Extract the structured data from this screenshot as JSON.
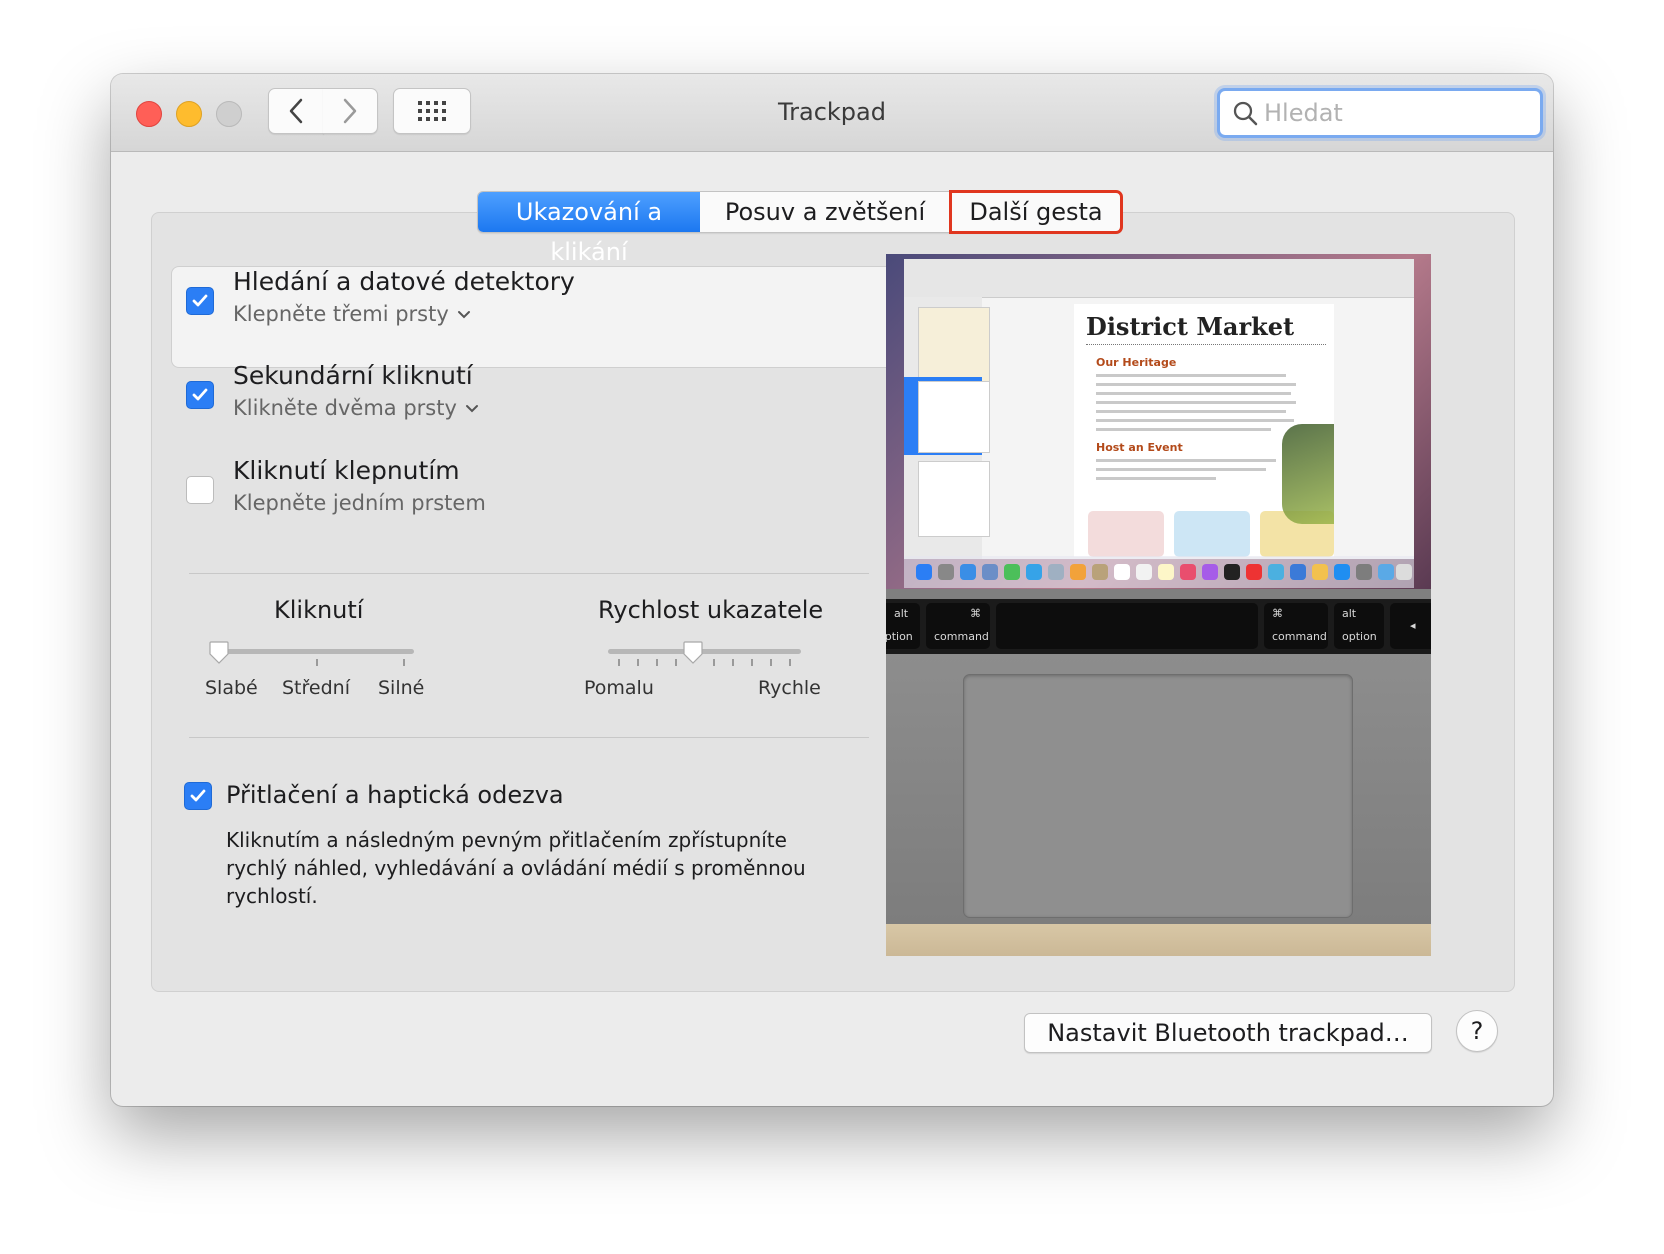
{
  "window": {
    "title": "Trackpad",
    "search_placeholder": "Hledat"
  },
  "tabs": [
    {
      "label": "Ukazování a klikání",
      "active": true
    },
    {
      "label": "Posuv a zvětšení",
      "active": false
    },
    {
      "label": "Další gesta",
      "active": false,
      "highlighted": true
    }
  ],
  "options": [
    {
      "title": "Hledání a datové detektory",
      "subtitle": "Klepněte třemi prsty",
      "checked": true,
      "has_menu": true
    },
    {
      "title": "Sekundární kliknutí",
      "subtitle": "Klikněte dvěma prsty",
      "checked": true,
      "has_menu": true
    },
    {
      "title": "Kliknutí klepnutím",
      "subtitle": "Klepněte jedním prstem",
      "checked": false,
      "has_menu": false
    }
  ],
  "sliders": {
    "click": {
      "title": "Kliknutí",
      "labels": [
        "Slabé",
        "Střední",
        "Silné"
      ],
      "value_fraction": 0.0
    },
    "tracking": {
      "title": "Rychlost ukazatele",
      "labels": [
        "Pomalu",
        "Rychle"
      ],
      "value_fraction": 0.44
    }
  },
  "force_click": {
    "title": "Přitlačení a haptická odezva",
    "checked": true,
    "description": "Kliknutím a následným pevným přitlačením zpřístupníte rychlý náhled, vyhledávání a ovládání médií s proměnnou rychlostí."
  },
  "preview": {
    "doc_title": "District Market",
    "doc_heading_1": "Our Heritage",
    "doc_heading_2": "Host an Event",
    "keys": [
      {
        "symbol": "alt",
        "label": "option"
      },
      {
        "symbol": "⌘",
        "label": "command"
      },
      {
        "symbol": "⌘",
        "label": "command"
      },
      {
        "symbol": "alt",
        "label": "option"
      }
    ]
  },
  "footer": {
    "bluetooth_button": "Nastavit Bluetooth trackpad…",
    "help_button": "?"
  },
  "colors": {
    "accent": "#2b7ef5",
    "highlight_outline": "#e0361f"
  }
}
